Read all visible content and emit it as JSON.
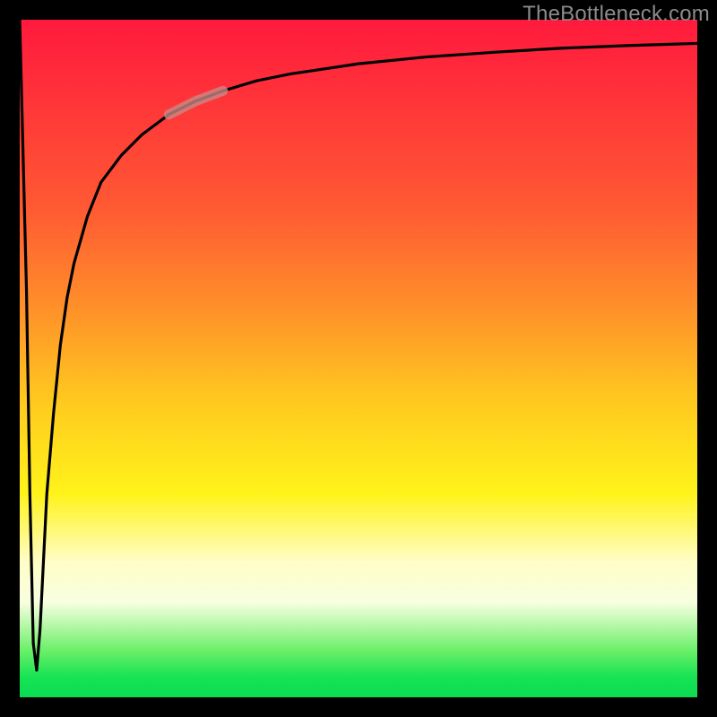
{
  "watermark": "TheBottleneck.com",
  "colors": {
    "background": "#000000",
    "curve": "#000000",
    "marker": "#c98a86",
    "gradient_stops": [
      "#ff1a3d",
      "#ff5a33",
      "#ffc81f",
      "#fff31a",
      "#fffdc8",
      "#17e354"
    ]
  },
  "chart_data": {
    "type": "line",
    "title": "",
    "xlabel": "",
    "ylabel": "",
    "xlim": [
      0,
      100
    ],
    "ylim": [
      0,
      100
    ],
    "grid": false,
    "legend": false,
    "series": [
      {
        "name": "bottleneck-curve",
        "x": [
          0.0,
          1.0,
          1.5,
          2.0,
          2.5,
          3.0,
          3.5,
          4.0,
          5.0,
          6.0,
          7.0,
          8.0,
          10.0,
          12.0,
          15.0,
          18.0,
          22.0,
          26.0,
          30.0,
          35.0,
          40.0,
          50.0,
          60.0,
          70.0,
          80.0,
          90.0,
          100.0
        ],
        "values": [
          100.0,
          60.0,
          30.0,
          8.0,
          4.0,
          10.0,
          20.0,
          30.0,
          42.0,
          52.0,
          59.0,
          64.0,
          71.0,
          76.0,
          80.0,
          83.0,
          86.0,
          88.0,
          89.5,
          91.0,
          92.0,
          93.5,
          94.5,
          95.2,
          95.8,
          96.2,
          96.5
        ]
      }
    ],
    "marker": {
      "x_range": [
        22,
        30
      ],
      "description": "highlighted segment on rising part of curve",
      "color": "#c98a86"
    }
  }
}
